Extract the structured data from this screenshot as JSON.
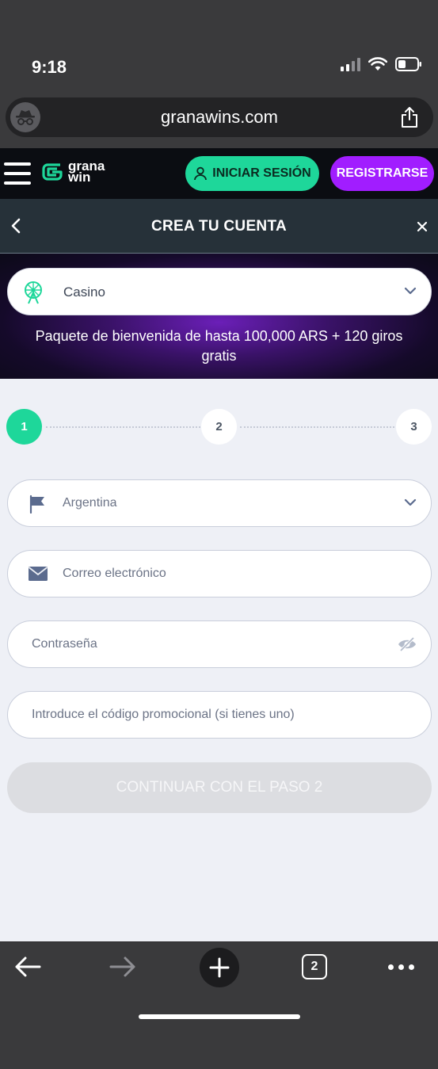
{
  "status_bar": {
    "time": "9:18"
  },
  "browser": {
    "url": "granawins.com",
    "tab_count": "2"
  },
  "site_header": {
    "logo_line1": "grana",
    "logo_line2": "win",
    "login_label": "INICIAR SESIÓN",
    "register_label": "REGISTRARSE"
  },
  "modal": {
    "title": "CREA TU CUENTA"
  },
  "banner": {
    "product": "Casino",
    "promo": "Paquete de bienvenida de hasta 100,000 ARS + 120 giros gratis"
  },
  "steps": [
    {
      "label": "1",
      "active": true
    },
    {
      "label": "2",
      "active": false
    },
    {
      "label": "3",
      "active": false
    }
  ],
  "form": {
    "country": "Argentina",
    "email_placeholder": "Correo electrónico",
    "password_placeholder": "Contraseña",
    "promo_placeholder": "Introduce el código promocional (si tienes uno)",
    "continue_label": "CONTINUAR CON EL PASO 2"
  },
  "colors": {
    "accent_green": "#1ed79a",
    "accent_purple": "#a11dff",
    "modal_bar": "#263139",
    "form_bg": "#eef0f6"
  },
  "icons": {
    "incognito": "incognito-icon",
    "share": "share-icon",
    "menu": "hamburger-menu-icon",
    "user": "user-icon",
    "back": "chevron-left-icon",
    "close": "close-icon",
    "casino": "ferris-wheel-icon",
    "dropdown": "chevron-down-icon",
    "country": "flag-icon",
    "email": "envelope-icon",
    "password": "eye-off-icon"
  }
}
